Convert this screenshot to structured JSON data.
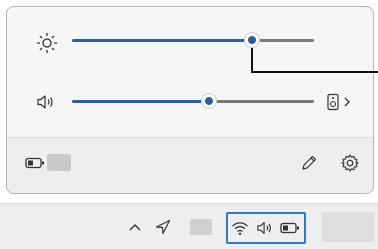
{
  "quick_settings": {
    "brightness": {
      "icon": "brightness-sun-icon",
      "level": 0.78
    },
    "volume": {
      "icon": "speaker-icon",
      "level": 0.55,
      "output_icon": "audio-output-device-icon",
      "chevron": ">"
    },
    "footer": {
      "battery_icon": "battery-icon",
      "edit_icon": "pencil-icon",
      "settings_icon": "gear-icon"
    }
  },
  "taskbar": {
    "overflow_chevron": "^",
    "tray_icons": [
      "wifi-icon",
      "speaker-icon",
      "battery-icon"
    ]
  },
  "colors": {
    "accent": "#2c5f9e",
    "highlight_border": "#2b7ec6",
    "panel_bg": "#f6f6f6"
  }
}
